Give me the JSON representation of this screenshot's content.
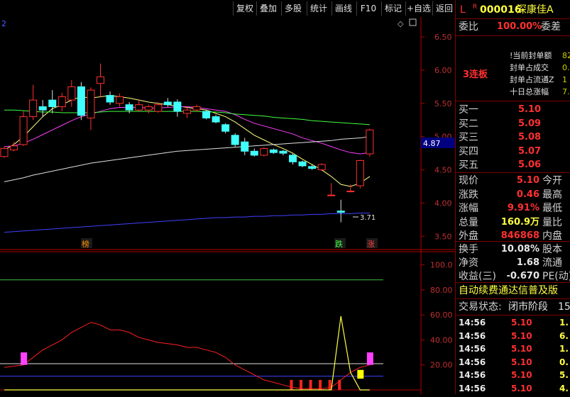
{
  "toolbar": {
    "buttons": [
      "复权",
      "叠加",
      "多股",
      "统计",
      "画线",
      "F10",
      "标记",
      "+自选",
      "返回"
    ]
  },
  "chart": {
    "corner_label": "2",
    "corner_glyph": "◇",
    "price_axis": [
      "6.50",
      "6.00",
      "5.50",
      "5.00",
      "4.50",
      "4.00",
      "3.50"
    ],
    "current_price": "4.87",
    "low_marker": "3.71",
    "event_markers": [
      "榜",
      "跌",
      "涨"
    ],
    "indicator_axis": [
      "100.0",
      "80.00",
      "60.00",
      "40.00",
      "20.00"
    ]
  },
  "chart_data": {
    "type": "candlestick",
    "y_range": [
      3.3,
      6.8
    ],
    "candles": [
      {
        "o": 4.7,
        "c": 4.82,
        "h": 4.85,
        "l": 4.68
      },
      {
        "o": 4.8,
        "c": 4.86,
        "h": 4.92,
        "l": 4.78
      },
      {
        "o": 4.88,
        "c": 5.3,
        "h": 5.38,
        "l": 4.86
      },
      {
        "o": 5.3,
        "c": 5.55,
        "h": 5.78,
        "l": 5.25
      },
      {
        "o": 5.45,
        "c": 5.4,
        "h": 5.55,
        "l": 5.3
      },
      {
        "o": 5.55,
        "c": 5.45,
        "h": 5.7,
        "l": 5.35
      },
      {
        "o": 5.45,
        "c": 5.6,
        "h": 5.66,
        "l": 5.38
      },
      {
        "o": 5.55,
        "c": 5.75,
        "h": 5.85,
        "l": 5.45
      },
      {
        "o": 5.75,
        "c": 5.32,
        "h": 5.82,
        "l": 5.25
      },
      {
        "o": 5.28,
        "c": 5.7,
        "h": 5.74,
        "l": 5.1
      },
      {
        "o": 5.8,
        "c": 5.9,
        "h": 6.1,
        "l": 5.6
      },
      {
        "o": 5.62,
        "c": 5.52,
        "h": 5.68,
        "l": 5.48
      },
      {
        "o": 5.5,
        "c": 5.6,
        "h": 5.65,
        "l": 5.45
      },
      {
        "o": 5.48,
        "c": 5.4,
        "h": 5.52,
        "l": 5.35
      },
      {
        "o": 5.4,
        "c": 5.48,
        "h": 5.55,
        "l": 5.38
      },
      {
        "o": 5.4,
        "c": 5.45,
        "h": 5.48,
        "l": 5.35
      },
      {
        "o": 5.38,
        "c": 5.48,
        "h": 5.52,
        "l": 5.36
      },
      {
        "o": 5.52,
        "c": 5.48,
        "h": 5.58,
        "l": 5.45
      },
      {
        "o": 5.52,
        "c": 5.38,
        "h": 5.56,
        "l": 5.3
      },
      {
        "o": 5.35,
        "c": 5.4,
        "h": 5.45,
        "l": 5.28
      },
      {
        "o": 5.4,
        "c": 5.45,
        "h": 5.48,
        "l": 5.38
      },
      {
        "o": 5.38,
        "c": 5.28,
        "h": 5.4,
        "l": 5.26
      },
      {
        "o": 5.3,
        "c": 5.22,
        "h": 5.33,
        "l": 5.2
      },
      {
        "o": 5.18,
        "c": 5.08,
        "h": 5.2,
        "l": 5.05
      },
      {
        "o": 5.02,
        "c": 4.88,
        "h": 5.05,
        "l": 4.85
      },
      {
        "o": 4.92,
        "c": 4.78,
        "h": 4.98,
        "l": 4.72
      },
      {
        "o": 4.78,
        "c": 4.72,
        "h": 4.82,
        "l": 4.7
      },
      {
        "o": 4.72,
        "c": 4.82,
        "h": 4.84,
        "l": 4.7
      },
      {
        "o": 4.8,
        "c": 4.76,
        "h": 4.82,
        "l": 4.74
      },
      {
        "o": 4.78,
        "c": 4.75,
        "h": 4.8,
        "l": 4.72
      },
      {
        "o": 4.72,
        "c": 4.62,
        "h": 4.74,
        "l": 4.58
      },
      {
        "o": 4.62,
        "c": 4.56,
        "h": 4.64,
        "l": 4.54
      },
      {
        "o": 4.55,
        "c": 4.52,
        "h": 4.58,
        "l": 4.5
      },
      {
        "o": 4.5,
        "c": 4.58,
        "h": 4.6,
        "l": 4.48
      },
      {
        "o": 4.12,
        "c": 4.12,
        "h": 4.3,
        "l": 4.12
      },
      {
        "o": 3.88,
        "c": 3.86,
        "h": 4.05,
        "l": 3.71
      },
      {
        "o": 4.18,
        "c": 4.18,
        "h": 4.28,
        "l": 4.16
      },
      {
        "o": 4.26,
        "c": 4.64,
        "h": 4.65,
        "l": 4.22
      },
      {
        "o": 4.74,
        "c": 5.1,
        "h": 5.12,
        "l": 4.7
      }
    ],
    "ma_lines": [
      {
        "color": "#ffff80",
        "values": [
          4.8,
          4.88,
          5.0,
          5.15,
          5.3,
          5.42,
          5.48,
          5.55,
          5.6,
          5.58,
          5.6,
          5.62,
          5.6,
          5.58,
          5.55,
          5.52,
          5.5,
          5.48,
          5.46,
          5.44,
          5.42,
          5.4,
          5.35,
          5.3,
          5.22,
          5.12,
          5.02,
          4.95,
          4.88,
          4.82,
          4.75,
          4.66,
          4.58,
          4.5,
          4.4,
          4.28,
          4.25,
          4.3,
          4.4
        ]
      },
      {
        "color": "#ff40ff",
        "values": [
          4.85,
          4.86,
          4.9,
          4.96,
          5.03,
          5.1,
          5.17,
          5.24,
          5.3,
          5.34,
          5.38,
          5.42,
          5.44,
          5.44,
          5.44,
          5.43,
          5.43,
          5.44,
          5.45,
          5.45,
          5.44,
          5.42,
          5.4,
          5.38,
          5.33,
          5.26,
          5.2,
          5.16,
          5.12,
          5.08,
          5.04,
          4.98,
          4.94,
          4.9,
          4.85,
          4.8,
          4.76,
          4.74,
          4.76
        ]
      },
      {
        "color": "#40ff40",
        "values": [
          5.4,
          5.4,
          5.39,
          5.38,
          5.37,
          5.37,
          5.36,
          5.36,
          5.36,
          5.36,
          5.37,
          5.38,
          5.38,
          5.38,
          5.38,
          5.38,
          5.38,
          5.38,
          5.38,
          5.38,
          5.38,
          5.37,
          5.37,
          5.36,
          5.34,
          5.33,
          5.32,
          5.31,
          5.29,
          5.28,
          5.27,
          5.26,
          5.24,
          5.23,
          5.22,
          5.21,
          5.2,
          5.19,
          5.18
        ]
      },
      {
        "color": "#e0e0e0",
        "values": [
          4.32,
          4.35,
          4.38,
          4.42,
          4.45,
          4.48,
          4.51,
          4.54,
          4.57,
          4.6,
          4.62,
          4.64,
          4.66,
          4.68,
          4.7,
          4.72,
          4.74,
          4.76,
          4.78,
          4.79,
          4.8,
          4.81,
          4.82,
          4.83,
          4.84,
          4.85,
          4.86,
          4.87,
          4.88,
          4.89,
          4.9,
          4.91,
          4.92,
          4.93,
          4.94,
          4.96,
          4.97,
          4.98,
          5.0
        ]
      },
      {
        "color": "#4040ff",
        "values": [
          3.56,
          3.57,
          3.58,
          3.59,
          3.6,
          3.61,
          3.62,
          3.63,
          3.64,
          3.65,
          3.66,
          3.67,
          3.68,
          3.69,
          3.7,
          3.71,
          3.72,
          3.73,
          3.74,
          3.75,
          3.76,
          3.77,
          3.78,
          3.78,
          3.79,
          3.79,
          3.8,
          3.8,
          3.81,
          3.81,
          3.82,
          3.82,
          3.83,
          3.83,
          3.84,
          3.84,
          3.84,
          3.85,
          3.85
        ]
      }
    ],
    "indicator": {
      "y_range": [
        0,
        110
      ],
      "red_line": [
        18,
        19,
        20,
        26,
        32,
        36,
        40,
        46,
        50,
        54,
        52,
        48,
        48,
        46,
        42,
        40,
        38,
        37,
        36,
        34,
        34,
        32,
        30,
        26,
        20,
        16,
        12,
        8,
        6,
        4,
        2,
        1,
        1,
        1,
        2,
        8,
        14,
        18,
        20
      ],
      "yellow_line": [
        0,
        0,
        0,
        0,
        0,
        0,
        0,
        0,
        0,
        0,
        0,
        0,
        0,
        0,
        0,
        0,
        0,
        0,
        0,
        0,
        0,
        0,
        0,
        0,
        0,
        0,
        0,
        0,
        0,
        0,
        0,
        0,
        0,
        0,
        0,
        59,
        14,
        0,
        0
      ],
      "level_lines": [
        {
          "v": 88,
          "color": "#40c040"
        },
        {
          "v": 21,
          "color": "#e0e0e0"
        },
        {
          "v": 11,
          "color": "#4040ff"
        }
      ]
    }
  },
  "right_panel": {
    "code_prefix": "L",
    "code_sup": "R",
    "code": "000016",
    "name": "深康佳A",
    "wei_label": "委比",
    "wei_value": "100.00%",
    "wei_cha": "委差",
    "lian_ban": "3连板",
    "seal_items": [
      "!当前封单额",
      "封单占成交",
      "封单占流通Z",
      "十日总涨幅"
    ],
    "seal_values": [
      "82",
      "0.",
      "1",
      "7."
    ],
    "orderbook": [
      {
        "label": "买一",
        "price": "5.10"
      },
      {
        "label": "买二",
        "price": "5.09"
      },
      {
        "label": "买三",
        "price": "5.08"
      },
      {
        "label": "买四",
        "price": "5.07"
      },
      {
        "label": "买五",
        "price": "5.06"
      }
    ],
    "quote": [
      {
        "label": "现价",
        "value": "5.10",
        "value_color": "red",
        "label2": "今开"
      },
      {
        "label": "涨跌",
        "value": "0.46",
        "value_color": "red",
        "label2": "最高"
      },
      {
        "label": "涨幅",
        "value": "9.91%",
        "value_color": "red",
        "label2": "最低"
      },
      {
        "label": "总量",
        "value": "160.9万",
        "value_color": "yel",
        "label2": "量比"
      },
      {
        "label": "外盘",
        "value": "846868",
        "value_color": "red",
        "label2": "内盘"
      }
    ],
    "stats": [
      {
        "label": "换手",
        "value": "10.08%",
        "label2": "股本"
      },
      {
        "label": "净资",
        "value": "1.68",
        "label2": "流通"
      },
      {
        "label": "收益(三)",
        "value": "-0.670",
        "label2": "PE(动)"
      }
    ],
    "banner": "自动续费通达信普及版",
    "trade_status_label": "交易状态:",
    "trade_status_value": "闭市阶段",
    "trade_status_time": "15:",
    "ticks": [
      {
        "time": "14:56",
        "price": "5.10",
        "vol": "1."
      },
      {
        "time": "14:56",
        "price": "5.10",
        "vol": "6."
      },
      {
        "time": "14:56",
        "price": "5.10",
        "vol": "1."
      },
      {
        "time": "14:56",
        "price": "5.10",
        "vol": "0."
      },
      {
        "time": "14:56",
        "price": "5.10",
        "vol": "5."
      },
      {
        "time": "14:56",
        "price": "5.10",
        "vol": "4."
      },
      {
        "time": "14:56",
        "price": "5.10",
        "vol": ""
      }
    ]
  }
}
